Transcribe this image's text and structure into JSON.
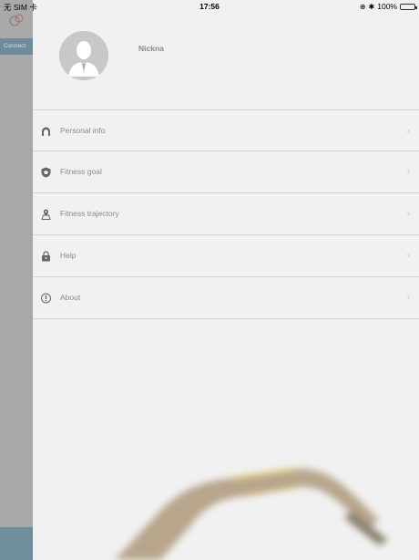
{
  "status_bar": {
    "carrier": "无 SIM 卡",
    "time": "17:56",
    "battery": "100%"
  },
  "background": {
    "tab_text": "Connect"
  },
  "profile": {
    "nickname": "Nickna"
  },
  "menu": {
    "items": [
      {
        "label": "Personal info",
        "icon": "person-icon"
      },
      {
        "label": "Fitness goal",
        "icon": "shield-icon"
      },
      {
        "label": "Fitness trajectory",
        "icon": "map-pin-icon"
      },
      {
        "label": "Help",
        "icon": "lock-icon"
      },
      {
        "label": "About",
        "icon": "info-icon"
      }
    ],
    "chevron": "›"
  },
  "colors": {
    "drawer_bg": "#f1f1f1",
    "divider": "#d4d4d4",
    "battery": "#2eb82e",
    "left_strip": "#a9a9a9",
    "accent_tab": "#6f8a98"
  }
}
